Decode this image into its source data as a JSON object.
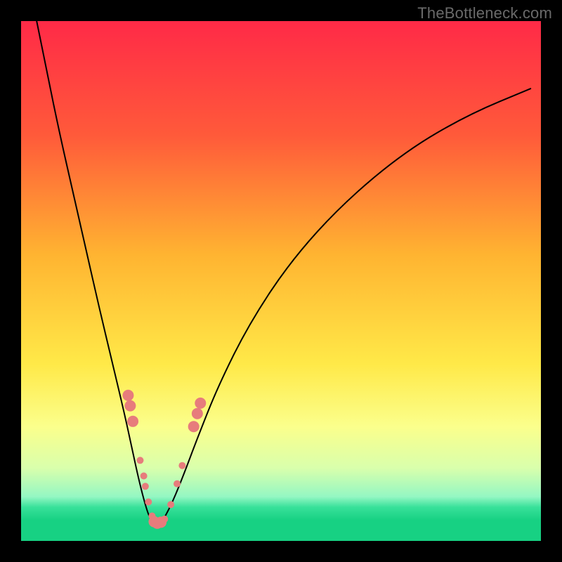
{
  "watermark": "TheBottleneck.com",
  "chart_data": {
    "type": "line",
    "title": "",
    "xlabel": "",
    "ylabel": "",
    "xlim": [
      0,
      100
    ],
    "ylim": [
      0,
      100
    ],
    "grid": false,
    "legend": false,
    "background_gradient": {
      "stops": [
        {
          "pos": 0.0,
          "color": "#ff2a47"
        },
        {
          "pos": 0.22,
          "color": "#ff5a3a"
        },
        {
          "pos": 0.45,
          "color": "#ffb431"
        },
        {
          "pos": 0.66,
          "color": "#ffe948"
        },
        {
          "pos": 0.78,
          "color": "#fbff8c"
        },
        {
          "pos": 0.86,
          "color": "#d9ffac"
        },
        {
          "pos": 0.915,
          "color": "#94f7c3"
        },
        {
          "pos": 0.935,
          "color": "#38e19a"
        },
        {
          "pos": 0.96,
          "color": "#17d183"
        },
        {
          "pos": 1.0,
          "color": "#17d183"
        }
      ]
    },
    "series": [
      {
        "name": "left-branch",
        "color": "#000000",
        "width": 2,
        "x": [
          3.0,
          5.0,
          7.5,
          10.0,
          12.5,
          15.0,
          17.5,
          20.0,
          21.5,
          22.6,
          23.6,
          24.5,
          25.3
        ],
        "y": [
          100.0,
          90.0,
          78.0,
          67.0,
          56.0,
          45.0,
          34.5,
          24.0,
          17.0,
          12.0,
          8.0,
          5.0,
          3.5
        ]
      },
      {
        "name": "right-branch",
        "color": "#000000",
        "width": 2,
        "x": [
          27.0,
          28.5,
          31.0,
          34.0,
          38.0,
          44.0,
          52.0,
          62.0,
          74.0,
          86.0,
          98.0
        ],
        "y": [
          3.5,
          6.0,
          12.0,
          20.0,
          30.0,
          42.0,
          54.0,
          65.0,
          75.0,
          82.0,
          87.0
        ]
      },
      {
        "name": "flat-bottom",
        "color": "#000000",
        "width": 2,
        "x": [
          25.3,
          26.0,
          27.0
        ],
        "y": [
          3.5,
          3.3,
          3.5
        ]
      }
    ],
    "markers": {
      "color": "#e77c7c",
      "radius_small": 5,
      "radius_large": 8,
      "points": [
        {
          "x": 20.6,
          "y": 28.0,
          "r": 8
        },
        {
          "x": 21.0,
          "y": 26.0,
          "r": 8
        },
        {
          "x": 21.5,
          "y": 23.0,
          "r": 8
        },
        {
          "x": 22.9,
          "y": 15.5,
          "r": 5
        },
        {
          "x": 23.6,
          "y": 12.5,
          "r": 5
        },
        {
          "x": 23.9,
          "y": 10.5,
          "r": 5
        },
        {
          "x": 24.5,
          "y": 7.5,
          "r": 5
        },
        {
          "x": 25.2,
          "y": 4.8,
          "r": 5
        },
        {
          "x": 25.6,
          "y": 3.7,
          "r": 8
        },
        {
          "x": 26.2,
          "y": 3.4,
          "r": 8
        },
        {
          "x": 26.9,
          "y": 3.6,
          "r": 8
        },
        {
          "x": 27.6,
          "y": 4.2,
          "r": 5
        },
        {
          "x": 28.8,
          "y": 7.0,
          "r": 5
        },
        {
          "x": 30.0,
          "y": 11.0,
          "r": 5
        },
        {
          "x": 31.0,
          "y": 14.5,
          "r": 5
        },
        {
          "x": 33.2,
          "y": 22.0,
          "r": 8
        },
        {
          "x": 33.9,
          "y": 24.5,
          "r": 8
        },
        {
          "x": 34.5,
          "y": 26.5,
          "r": 8
        }
      ]
    }
  }
}
